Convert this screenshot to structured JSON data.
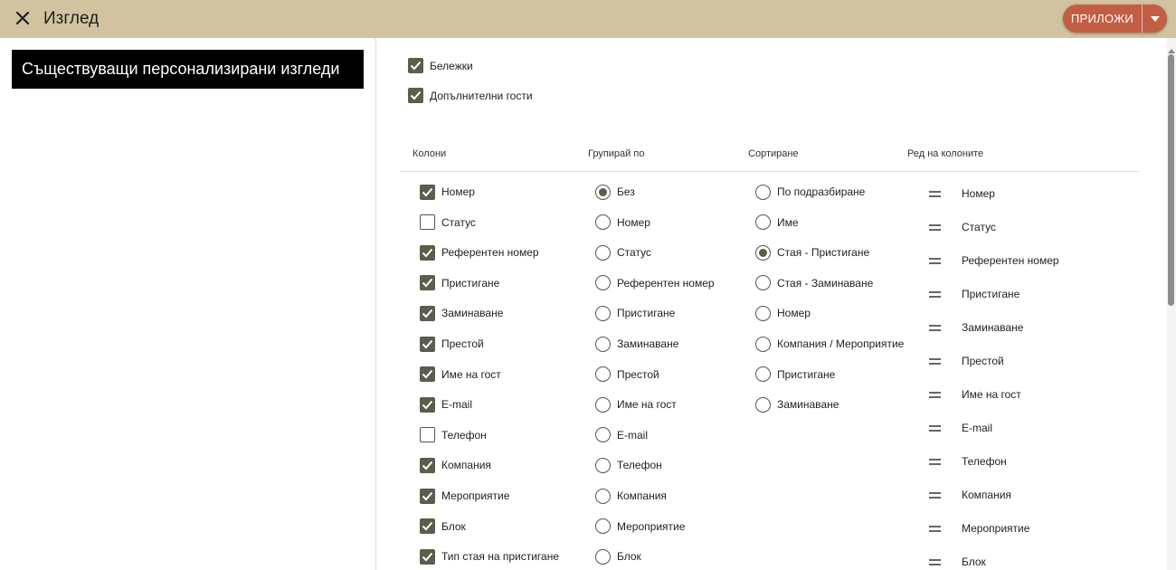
{
  "header": {
    "title": "Изглед",
    "apply_label": "ПРИЛОЖИ"
  },
  "left": {
    "existing_views_label": "Съществуващи персонализирани изгледи"
  },
  "top_options": [
    {
      "label": "Бележки",
      "checked": true
    },
    {
      "label": "Допълнителни гости",
      "checked": true
    }
  ],
  "columns_header": "Колони",
  "group_header": "Групирай по",
  "sort_header": "Сортиране",
  "order_header": "Ред на колоните",
  "columns": [
    {
      "label": "Номер",
      "checked": true
    },
    {
      "label": "Статус",
      "checked": false
    },
    {
      "label": "Референтен номер",
      "checked": true
    },
    {
      "label": "Пристигане",
      "checked": true
    },
    {
      "label": "Заминаване",
      "checked": true
    },
    {
      "label": "Престой",
      "checked": true
    },
    {
      "label": "Име на гост",
      "checked": true
    },
    {
      "label": "E-mail",
      "checked": true
    },
    {
      "label": "Телефон",
      "checked": false
    },
    {
      "label": "Компания",
      "checked": true
    },
    {
      "label": "Мероприятие",
      "checked": true
    },
    {
      "label": "Блок",
      "checked": true
    },
    {
      "label": "Тип стая на пристигане",
      "checked": true
    }
  ],
  "group_by": [
    {
      "label": "Без",
      "selected": true
    },
    {
      "label": "Номер",
      "selected": false
    },
    {
      "label": "Статус",
      "selected": false
    },
    {
      "label": "Референтен номер",
      "selected": false
    },
    {
      "label": "Пристигане",
      "selected": false
    },
    {
      "label": "Заминаване",
      "selected": false
    },
    {
      "label": "Престой",
      "selected": false
    },
    {
      "label": "Име на гост",
      "selected": false
    },
    {
      "label": "E-mail",
      "selected": false
    },
    {
      "label": "Телефон",
      "selected": false
    },
    {
      "label": "Компания",
      "selected": false
    },
    {
      "label": "Мероприятие",
      "selected": false
    },
    {
      "label": "Блок",
      "selected": false
    }
  ],
  "sort_by": [
    {
      "label": "По подразбиране",
      "selected": false
    },
    {
      "label": "Име",
      "selected": false
    },
    {
      "label": "Стая - Пристигане",
      "selected": true
    },
    {
      "label": "Стая - Заминаване",
      "selected": false
    },
    {
      "label": "Номер",
      "selected": false
    },
    {
      "label": "Компания / Мероприятие",
      "selected": false
    },
    {
      "label": "Пристигане",
      "selected": false
    },
    {
      "label": "Заминаване",
      "selected": false
    }
  ],
  "column_order": [
    "Номер",
    "Статус",
    "Референтен номер",
    "Пристигане",
    "Заминаване",
    "Престой",
    "Име на гост",
    "E-mail",
    "Телефон",
    "Компания",
    "Мероприятие",
    "Блок"
  ],
  "colors": {
    "header_bg": "#d2c3a0",
    "apply_bg": "#c25e44",
    "checkbox_on": "#5b5e4c"
  }
}
